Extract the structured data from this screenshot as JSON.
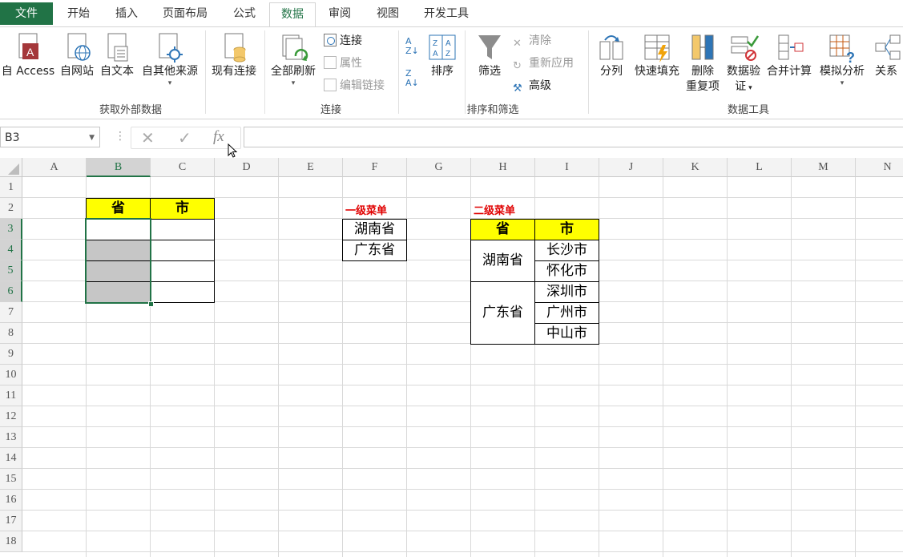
{
  "tabs": [
    {
      "label": "文件",
      "active": false,
      "file": true
    },
    {
      "label": "开始"
    },
    {
      "label": "插入"
    },
    {
      "label": "页面布局"
    },
    {
      "label": "公式"
    },
    {
      "label": "数据",
      "active": true
    },
    {
      "label": "审阅"
    },
    {
      "label": "视图"
    },
    {
      "label": "开发工具"
    }
  ],
  "ribbon": {
    "get_external": {
      "group_label": "获取外部数据",
      "access": "自 Access",
      "web": "自网站",
      "text": "自文本",
      "other": "自其他来源",
      "existing": "现有连接"
    },
    "connections": {
      "group_label": "连接",
      "refresh_all": "全部刷新",
      "connections": "连接",
      "properties": "属性",
      "edit_links": "编辑链接"
    },
    "sort_filter": {
      "group_label": "排序和筛选",
      "sort": "排序",
      "filter": "筛选",
      "clear": "清除",
      "reapply": "重新应用",
      "advanced": "高级"
    },
    "data_tools": {
      "group_label": "数据工具",
      "text_to_columns": "分列",
      "flash_fill": "快速填充",
      "remove_dup_1": "删除",
      "remove_dup_2": "重复项",
      "validation_1": "数据验",
      "validation_2": "证",
      "consolidate": "合并计算",
      "what_if": "模拟分析",
      "relationships": "关系"
    }
  },
  "formula_bar": {
    "name_box": "B3",
    "fx": "fx",
    "formula": ""
  },
  "columns": [
    "A",
    "B",
    "C",
    "D",
    "E",
    "F",
    "G",
    "H",
    "I",
    "J",
    "K",
    "L",
    "M",
    "N"
  ],
  "rows": [
    "1",
    "2",
    "3",
    "4",
    "5",
    "6",
    "7",
    "8",
    "9",
    "10",
    "11",
    "12",
    "13",
    "14",
    "15",
    "16",
    "17",
    "18"
  ],
  "sheet": {
    "b2": "省",
    "c2": "市",
    "f2_label": "一级菜单",
    "f3": "湖南省",
    "f4": "广东省",
    "h2_label": "二级菜单",
    "h3": "省",
    "i3": "市",
    "h_hunan": "湖南省",
    "h_guangdong": "广东省",
    "i4": "长沙市",
    "i5": "怀化市",
    "i6": "深圳市",
    "i7": "广州市",
    "i8": "中山市"
  },
  "colors": {
    "accent": "#217346",
    "header_fill": "#ffff00",
    "label_red": "#e00000"
  }
}
